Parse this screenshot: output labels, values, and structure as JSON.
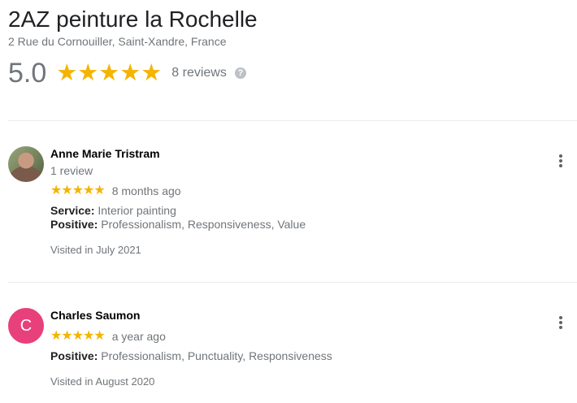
{
  "business": {
    "name": "2AZ peinture la Rochelle",
    "address": "2 Rue du Cornouiller, Saint-Xandre, France",
    "rating": "5.0",
    "stars": "★★★★★",
    "review_count": "8 reviews",
    "help_glyph": "?"
  },
  "colors": {
    "star": "#f4b400",
    "avatar_c": "#e8407a"
  },
  "reviews": [
    {
      "name": "Anne Marie Tristram",
      "meta": "1 review",
      "stars": "★★★★★",
      "rating": 5,
      "time": "8 months ago",
      "service_label": "Service:",
      "service_value": "Interior painting",
      "positive_label": "Positive:",
      "positive_value": "Professionalism, Responsiveness, Value",
      "visited": "Visited in July 2021"
    },
    {
      "name": "Charles Saumon",
      "avatar_letter": "C",
      "stars": "★★★★★",
      "rating": 5,
      "time": "a year ago",
      "positive_label": "Positive:",
      "positive_value": "Professionalism, Punctuality, Responsiveness",
      "visited": "Visited in August 2020"
    }
  ]
}
